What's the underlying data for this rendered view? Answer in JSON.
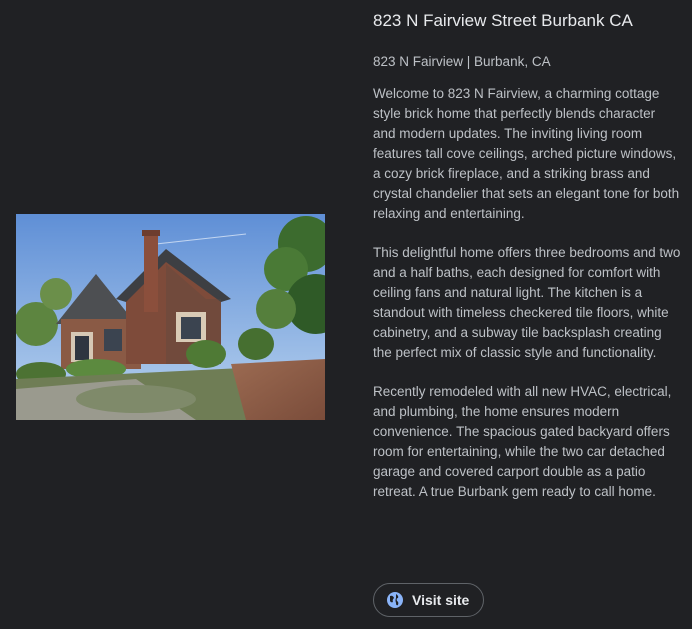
{
  "listing": {
    "title": "823 N Fairview Street Burbank CA",
    "subtitle": "823 N Fairview | Burbank, CA",
    "paragraphs": [
      "Welcome to 823 N Fairview, a charming cottage style brick home that perfectly blends character and modern updates. The inviting living room features tall cove ceilings, arched picture windows, a cozy brick fireplace, and a striking brass and crystal chandelier that sets an elegant tone for both relaxing and entertaining.",
      "This delightful home offers three bedrooms and two and a half baths, each designed for comfort with ceiling fans and natural light. The kitchen is a standout with timeless checkered tile floors, white cabinetry, and a subway tile backsplash creating the perfect mix of classic style and functionality.",
      "Recently remodeled with all new HVAC, electrical, and plumbing, the home ensures modern convenience. The spacious gated backyard offers room for entertaining, while the two car detached garage and covered carport double as a patio retreat. A true Burbank gem ready to call home."
    ]
  },
  "actions": {
    "visit_label": "Visit site",
    "visit_icon": "globe-icon"
  },
  "colors": {
    "background": "#202124",
    "title": "#e8eaed",
    "body_text": "#bdc1c6",
    "button_border": "#5f6368",
    "globe": "#8ab4f8"
  }
}
